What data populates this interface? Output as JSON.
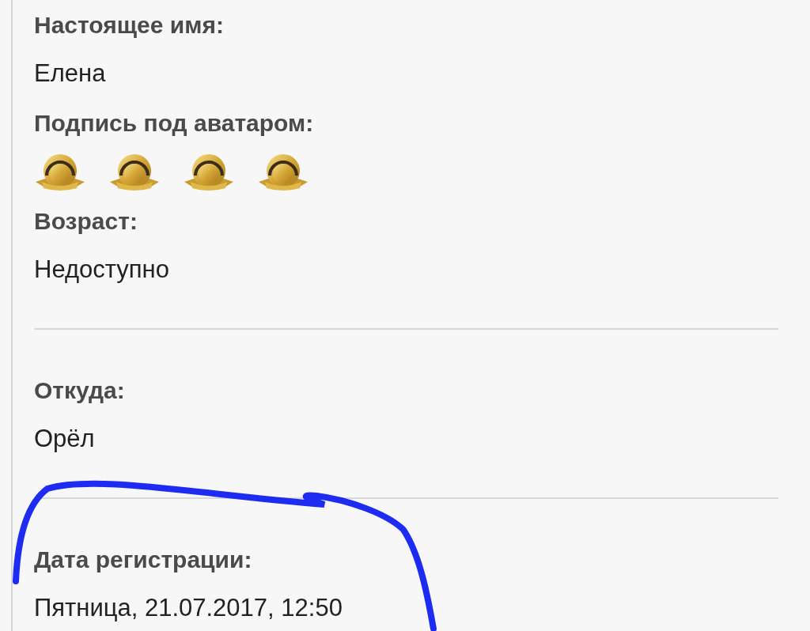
{
  "sections": [
    {
      "fields": [
        {
          "kind": "text",
          "label": "Настоящее имя:",
          "value": "Елена"
        },
        {
          "kind": "medals",
          "label": "Подпись под аватаром:",
          "stars": 4
        },
        {
          "kind": "text",
          "label": "Возраст:",
          "value": "Недоступно"
        }
      ]
    },
    {
      "fields": [
        {
          "kind": "text",
          "label": "Откуда:",
          "value": "Орёл"
        }
      ]
    },
    {
      "fields": [
        {
          "kind": "text",
          "label": "Дата регистрации:",
          "value": "Пятница, 21.07.2017, 12:50"
        }
      ]
    }
  ]
}
